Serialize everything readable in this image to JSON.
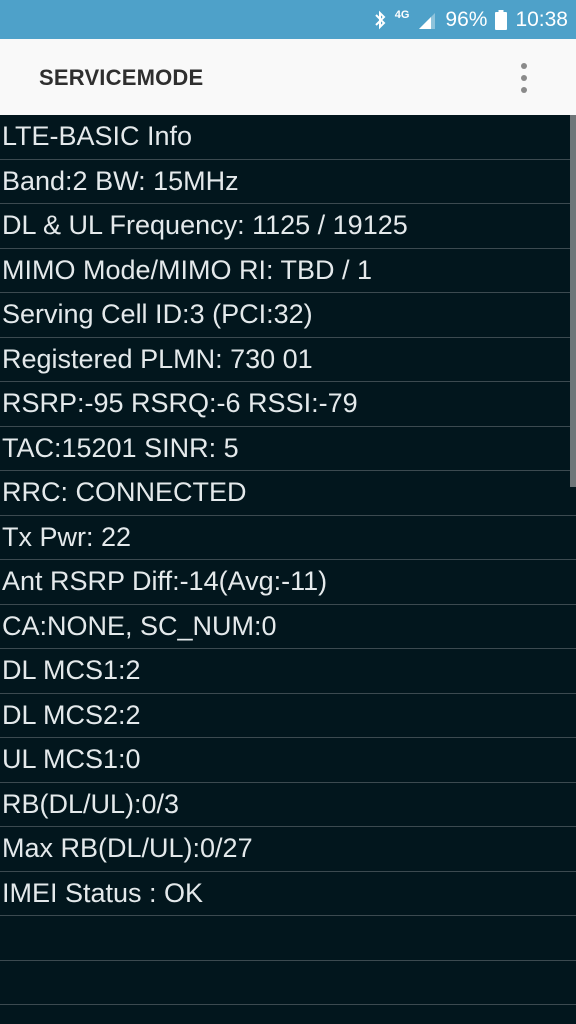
{
  "status_bar": {
    "network": "4G",
    "battery": "96%",
    "time": "10:38"
  },
  "header": {
    "title": "SERVICEMODE"
  },
  "rows": [
    "LTE-BASIC Info",
    "Band:2 BW: 15MHz",
    "DL & UL Frequency: 1125 / 19125",
    "MIMO Mode/MIMO RI: TBD / 1",
    "Serving Cell ID:3 (PCI:32)",
    "Registered PLMN: 730 01",
    "RSRP:-95 RSRQ:-6 RSSI:-79",
    "TAC:15201 SINR: 5",
    "RRC: CONNECTED",
    "Tx Pwr: 22",
    "Ant RSRP Diff:-14(Avg:-11)",
    "CA:NONE, SC_NUM:0",
    "DL MCS1:2",
    "DL MCS2:2",
    "UL MCS1:0",
    "RB(DL/UL):0/3",
    "Max RB(DL/UL):0/27",
    "IMEI Status : OK",
    "",
    ""
  ]
}
